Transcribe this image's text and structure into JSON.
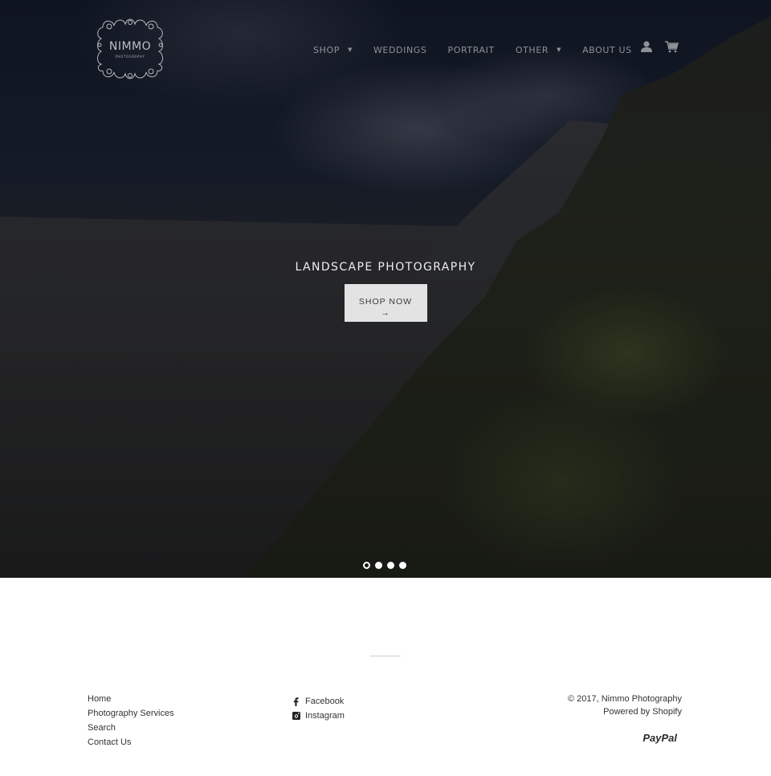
{
  "brand": {
    "name": "NIMMO",
    "tagline": "PHOTOGRAPHY"
  },
  "nav": {
    "items": [
      {
        "label": "SHOP",
        "has_dropdown": true
      },
      {
        "label": "WEDDINGS",
        "has_dropdown": false
      },
      {
        "label": "PORTRAIT",
        "has_dropdown": false
      },
      {
        "label": "OTHER",
        "has_dropdown": true
      },
      {
        "label": "ABOUT US",
        "has_dropdown": false
      }
    ],
    "caret": "▼",
    "icons": {
      "account": "user-icon",
      "cart": "cart-icon"
    }
  },
  "hero": {
    "title": "LANDSCAPE PHOTOGRAPHY",
    "button_label": "SHOP NOW",
    "button_arrow": "→",
    "slides_count": 4,
    "active_slide": 1
  },
  "footer": {
    "links": [
      "Home",
      "Photography Services",
      "Search",
      "Contact Us"
    ],
    "social": [
      {
        "label": "Facebook",
        "icon": "facebook-icon"
      },
      {
        "label": "Instagram",
        "icon": "instagram-icon"
      }
    ],
    "copyright": "© 2017, Nimmo Photography",
    "powered_by": "Powered by Shopify",
    "payment": "PayPal"
  },
  "colors": {
    "nav_text": "#8f9197",
    "button_bg": "#e3e3e3",
    "footer_text": "#333333"
  }
}
